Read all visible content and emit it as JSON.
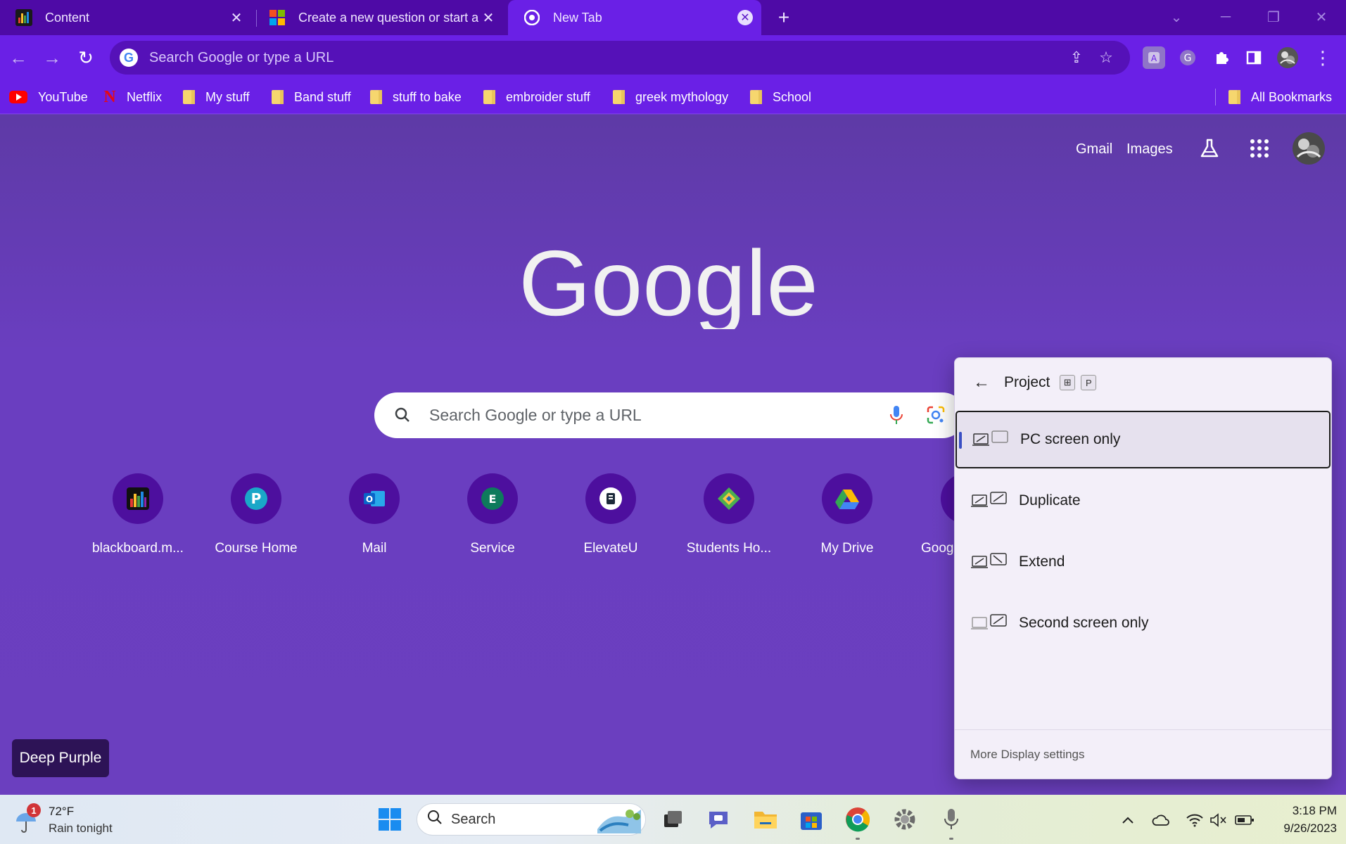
{
  "tabs": [
    {
      "title": "Content",
      "active": false
    },
    {
      "title": "Create a new question or start a d",
      "active": false
    },
    {
      "title": "New Tab",
      "active": true
    }
  ],
  "toolbar": {
    "omnibox_placeholder": "Search Google or type a URL"
  },
  "bookmarks": [
    {
      "label": "YouTube",
      "icon": "youtube-icon"
    },
    {
      "label": "Netflix",
      "icon": "netflix-icon"
    },
    {
      "label": "My stuff",
      "icon": "folder-icon"
    },
    {
      "label": "Band stuff",
      "icon": "folder-icon"
    },
    {
      "label": "stuff to bake",
      "icon": "folder-icon"
    },
    {
      "label": "embroider stuff",
      "icon": "folder-icon"
    },
    {
      "label": "greek mythology",
      "icon": "folder-icon"
    },
    {
      "label": "School",
      "icon": "folder-icon"
    }
  ],
  "all_bookmarks_label": "All Bookmarks",
  "ntp": {
    "gmail_label": "Gmail",
    "images_label": "Images",
    "logo_text": "Google",
    "search_placeholder": "Search Google or type a URL",
    "shortcuts": [
      {
        "label": "blackboard.m..."
      },
      {
        "label": "Course Home"
      },
      {
        "label": "Mail"
      },
      {
        "label": "Service"
      },
      {
        "label": "ElevateU"
      },
      {
        "label": "Students Ho..."
      },
      {
        "label": "My Drive"
      },
      {
        "label": "Goog"
      }
    ],
    "theme_name": "Deep Purple"
  },
  "project_panel": {
    "title": "Project",
    "shortcut_keys": [
      "⊞",
      "P"
    ],
    "options": [
      {
        "label": "PC screen only",
        "selected": true
      },
      {
        "label": "Duplicate",
        "selected": false
      },
      {
        "label": "Extend",
        "selected": false
      },
      {
        "label": "Second screen only",
        "selected": false
      }
    ],
    "footer_link": "More Display settings"
  },
  "taskbar": {
    "weather_badge": "1",
    "weather_temp": "72°F",
    "weather_desc": "Rain tonight",
    "search_placeholder": "Search",
    "time": "3:18 PM",
    "date": "9/26/2023"
  },
  "colors": {
    "tabstrip": "#4e0aa6",
    "toolbar": "#6a20e6",
    "page_bg": "#6b3fbf",
    "panel_bg": "#f3eff9",
    "selection_accent": "#3a4fc4"
  }
}
